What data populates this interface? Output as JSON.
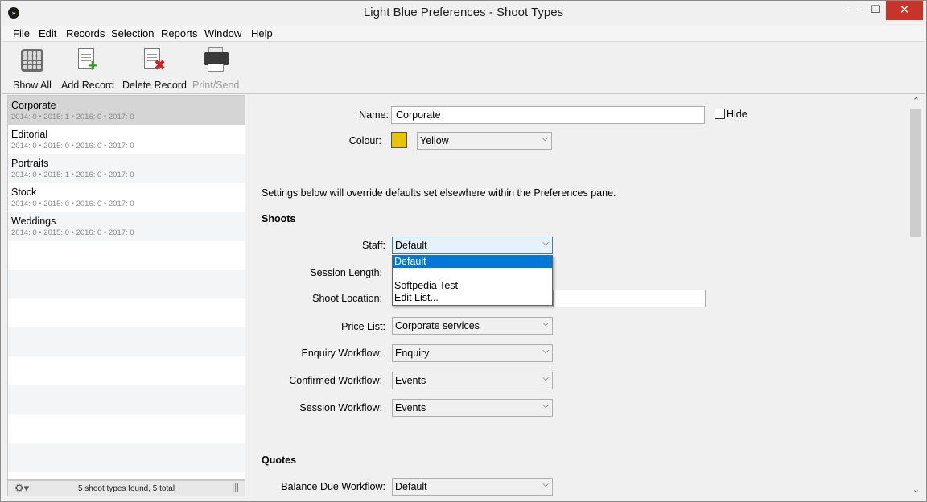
{
  "window": {
    "title": "Light Blue Preferences - Shoot Types",
    "app_icon": "»",
    "controls": {
      "minimize": "—",
      "maximize": "☐",
      "close": "✕"
    }
  },
  "menu": [
    "File",
    "Edit",
    "Records",
    "Selection",
    "Reports",
    "Window",
    "Help"
  ],
  "toolbar": {
    "show_all": "Show All",
    "add_record": "Add Record",
    "delete_record": "Delete Record",
    "print_send": "Print/Send"
  },
  "list": {
    "items": [
      {
        "name": "Corporate",
        "stats": "2014: 0   •   2015: 1   •   2016: 0   •   2017: 0"
      },
      {
        "name": "Editorial",
        "stats": "2014: 0   •   2015: 0   •   2016: 0   •   2017: 0"
      },
      {
        "name": "Portraits",
        "stats": "2014: 0   •   2015: 1   •   2016: 0   •   2017: 0"
      },
      {
        "name": "Stock",
        "stats": "2014: 0   •   2015: 0   •   2016: 0   •   2017: 0"
      },
      {
        "name": "Weddings",
        "stats": "2014: 0   •   2015: 0   •   2016: 0   •   2017: 0"
      }
    ],
    "status": "5 shoot types found, 5 total",
    "gear": "⚙▾",
    "grip": "|||"
  },
  "form": {
    "name_label": "Name:",
    "name_value": "Corporate",
    "hide_label": "Hide",
    "colour_label": "Colour:",
    "colour_value": "Yellow",
    "colour_hex": "#e8c400",
    "note": "Settings below will override defaults set elsewhere within the Preferences pane.",
    "shoots_heading": "Shoots",
    "staff_label": "Staff:",
    "staff_value": "Default",
    "session_length_label": "Session Length:",
    "shoot_location_label": "Shoot Location:",
    "price_list_label": "Price List:",
    "price_list_value": "Corporate services",
    "enquiry_label": "Enquiry Workflow:",
    "enquiry_value": "Enquiry",
    "confirmed_label": "Confirmed Workflow:",
    "confirmed_value": "Events",
    "session_label": "Session Workflow:",
    "session_value": "Events",
    "quotes_heading": "Quotes",
    "balance_label": "Balance Due Workflow:",
    "balance_value": "Default"
  },
  "staff_dropdown": {
    "options": [
      "Default",
      "-",
      "Softpedia Test",
      "Edit List..."
    ]
  },
  "glyphs": {
    "arrow": "⌵",
    "up": "⌃",
    "down": "⌄"
  }
}
